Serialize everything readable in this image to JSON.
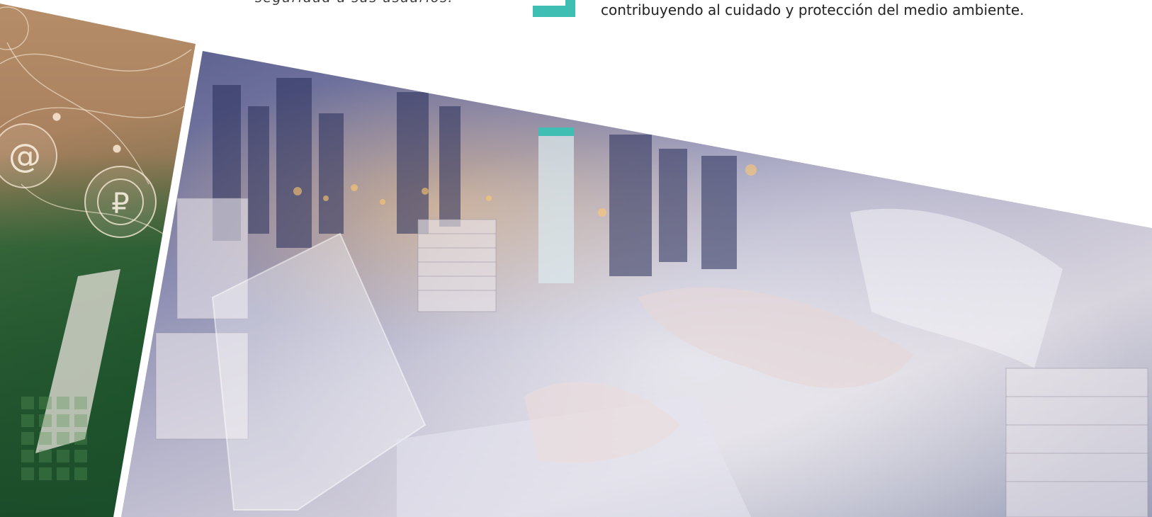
{
  "text": {
    "left_caption": "seguridad a sus usuarios.",
    "right_caption": "contribuyendo al cuidado y protección del medio ambiente."
  },
  "colors": {
    "accent_teal": "#3fbfb3"
  },
  "images": {
    "left_photo": "hand-on-laptop-with-network-icons-photo",
    "right_photo": "city-skyline-double-exposure-person-typing-laptop-photo"
  },
  "icons": [
    "at-sign-icon",
    "ruble-coin-icon"
  ],
  "icon_glyphs": {
    "at": "@",
    "ruble": "₽"
  }
}
